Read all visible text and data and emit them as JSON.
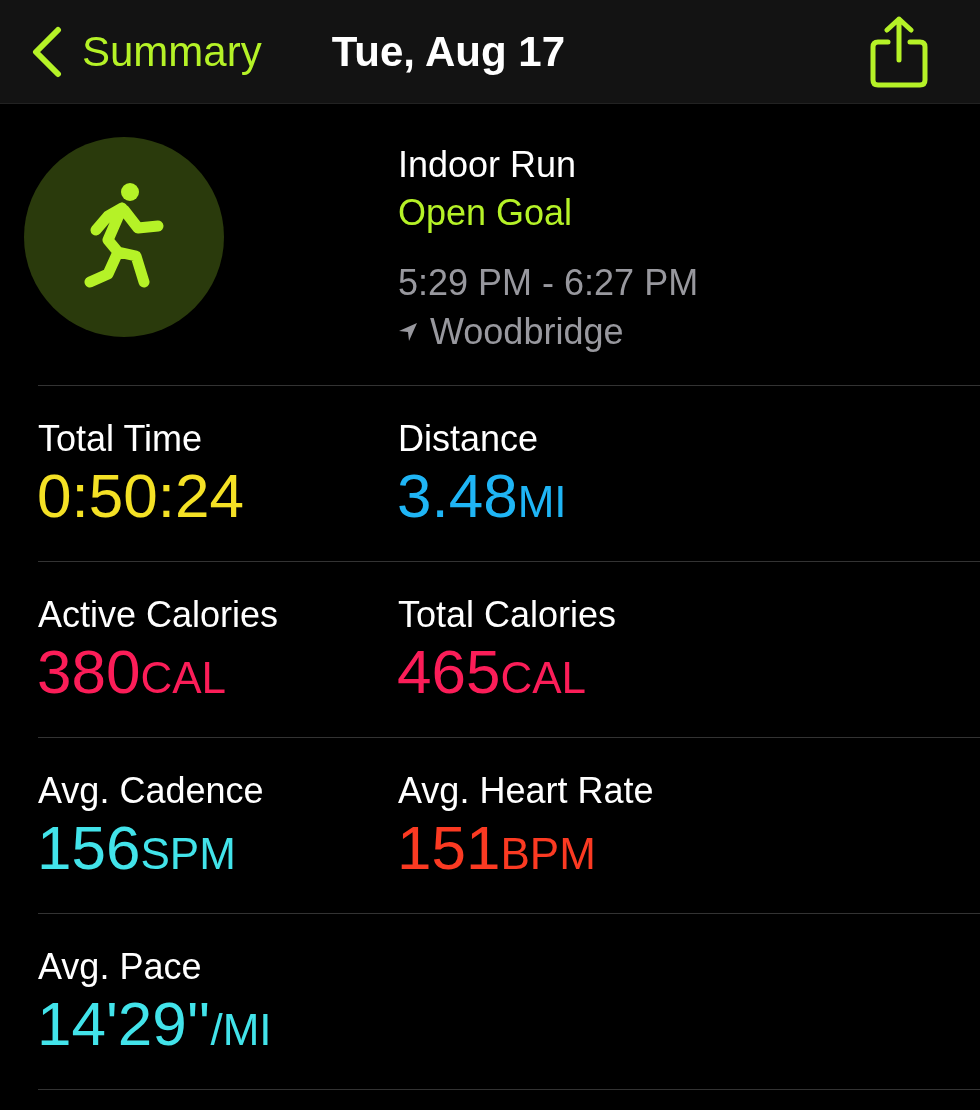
{
  "header": {
    "back_label": "Summary",
    "title": "Tue, Aug 17"
  },
  "workout": {
    "name": "Indoor Run",
    "goal": "Open Goal",
    "time_range": "5:29 PM - 6:27 PM",
    "location": "Woodbridge"
  },
  "metric_rows": [
    {
      "metrics": [
        {
          "label": "Total Time",
          "value": "0:50:24",
          "color": "#f4e125"
        },
        {
          "label": "Distance",
          "value": "3.48",
          "unit": "MI",
          "color": "#1fb5f5"
        }
      ]
    },
    {
      "metrics": [
        {
          "label": "Active Calories",
          "value": "380",
          "unit": "CAL",
          "color": "#fb1d58"
        },
        {
          "label": "Total Calories",
          "value": "465",
          "unit": "CAL",
          "color": "#fb1d58"
        }
      ]
    },
    {
      "metrics": [
        {
          "label": "Avg. Cadence",
          "value": "156",
          "unit": "SPM",
          "color": "#42e3ea"
        },
        {
          "label": "Avg. Heart Rate",
          "value": "151",
          "unit": "BPM",
          "color": "#fb3a22"
        }
      ]
    },
    {
      "metrics": [
        {
          "label": "Avg. Pace",
          "value": "14'29''",
          "unit": "/MI",
          "color": "#42e3ea"
        }
      ]
    }
  ]
}
